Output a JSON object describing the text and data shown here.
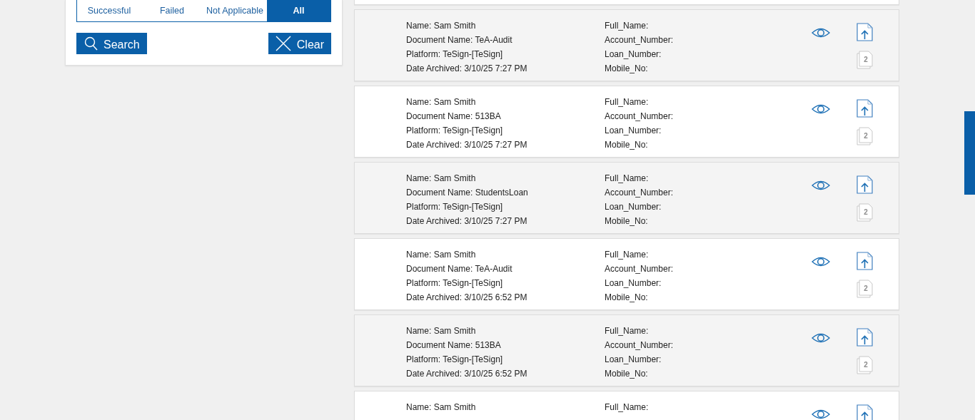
{
  "filter": {
    "options": [
      {
        "label": "Successful",
        "selected": false
      },
      {
        "label": "Failed",
        "selected": false
      },
      {
        "label": "Not Applicable",
        "selected": false
      },
      {
        "label": "All",
        "selected": true
      }
    ],
    "buttons": [
      {
        "kind": "search",
        "label": "Search"
      },
      {
        "kind": "clear",
        "label": "Clear"
      }
    ]
  },
  "results": [
    {
      "left": [
        "Name: Sam Smith",
        "Document Name: TeA-Audit",
        "Platform: TeSign-[TeSign]",
        "Date Archived: 3/10/25 7:27 PM"
      ],
      "right": [
        "Full_Name:",
        "Account_Number:",
        "Loan_Number:",
        "Mobile_No:"
      ],
      "copies": {
        "count": "2",
        "disabled": true
      }
    },
    {
      "left": [
        "Name: Sam Smith",
        "Document Name: 513BA",
        "Platform: TeSign-[TeSign]",
        "Date Archived: 3/10/25 7:27 PM"
      ],
      "right": [
        "Full_Name:",
        "Account_Number:",
        "Loan_Number:",
        "Mobile_No:"
      ],
      "copies": {
        "count": "2",
        "disabled": true
      }
    },
    {
      "left": [
        "Name: Sam Smith",
        "Document Name: StudentsLoan",
        "Platform: TeSign-[TeSign]",
        "Date Archived: 3/10/25 7:27 PM"
      ],
      "right": [
        "Full_Name:",
        "Account_Number:",
        "Loan_Number:",
        "Mobile_No:"
      ],
      "copies": {
        "count": "2",
        "disabled": true
      }
    },
    {
      "left": [
        "Name: Sam Smith",
        "Document Name: TeA-Audit",
        "Platform: TeSign-[TeSign]",
        "Date Archived: 3/10/25 6:52 PM"
      ],
      "right": [
        "Full_Name:",
        "Account_Number:",
        "Loan_Number:",
        "Mobile_No:"
      ],
      "copies": {
        "count": "2",
        "disabled": true
      }
    },
    {
      "left": [
        "Name: Sam Smith",
        "Document Name: 513BA",
        "Platform: TeSign-[TeSign]",
        "Date Archived: 3/10/25 6:52 PM"
      ],
      "right": [
        "Full_Name:",
        "Account_Number:",
        "Loan_Number:",
        "Mobile_No:"
      ],
      "copies": {
        "count": "2",
        "disabled": true
      }
    },
    {
      "left": [
        "Name: Sam Smith"
      ],
      "right": [
        "Full_Name:"
      ]
    }
  ]
}
